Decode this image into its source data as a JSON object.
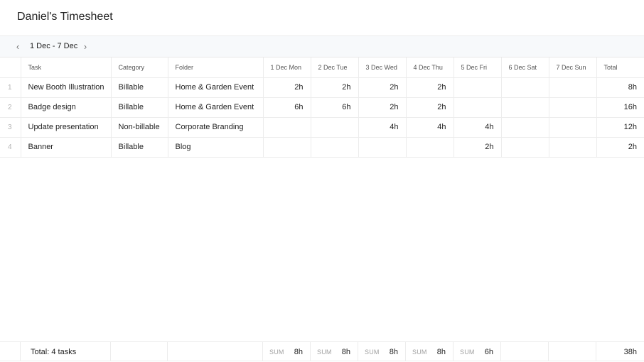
{
  "page": {
    "title": "Daniel's Timesheet"
  },
  "range": {
    "label": "1 Dec - 7 Dec",
    "prev_icon": "‹",
    "next_icon": "›"
  },
  "columns": [
    "Task",
    "Category",
    "Folder",
    "1 Dec Mon",
    "2 Dec Tue",
    "3 Dec Wed",
    "4 Dec Thu",
    "5 Dec Fri",
    "6 Dec Sat",
    "7 Dec Sun",
    "Total"
  ],
  "rows": [
    {
      "num": "1",
      "task": "New Booth Illustration",
      "category": "Billable",
      "folder": "Home & Garden Event",
      "days": [
        "2h",
        "2h",
        "2h",
        "2h",
        "",
        "",
        ""
      ],
      "total": "8h"
    },
    {
      "num": "2",
      "task": "Badge design",
      "category": "Billable",
      "folder": "Home & Garden Event",
      "days": [
        "6h",
        "6h",
        "2h",
        "2h",
        "",
        "",
        ""
      ],
      "total": "16h"
    },
    {
      "num": "3",
      "task": "Update presentation",
      "category": "Non-billable",
      "folder": "Corporate Branding",
      "days": [
        "",
        "",
        "4h",
        "4h",
        "4h",
        "",
        ""
      ],
      "total": "12h"
    },
    {
      "num": "4",
      "task": "Banner",
      "category": "Billable",
      "folder": "Blog",
      "days": [
        "",
        "",
        "",
        "",
        "2h",
        "",
        ""
      ],
      "total": "2h"
    }
  ],
  "footer": {
    "total_label": "Total: 4 tasks",
    "sum_tag": "SUM",
    "sums": [
      "8h",
      "8h",
      "8h",
      "8h",
      "6h"
    ],
    "grand_total": "38h"
  }
}
